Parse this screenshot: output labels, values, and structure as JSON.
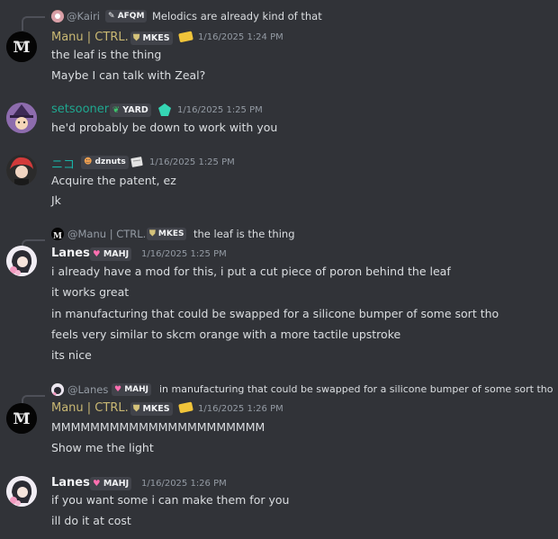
{
  "messages": {
    "m1": {
      "reply": {
        "name": "@Kairi",
        "tag": "AFQM",
        "text": "Melodics are already kind of that"
      },
      "author": "Manu | CTRL.",
      "tag": "MKES",
      "time": "1/16/2025 1:24 PM",
      "lines": [
        "the leaf is the thing",
        "Maybe I can talk with Zeal?"
      ]
    },
    "m2": {
      "author": "setsooner",
      "tag": "YARD",
      "time": "1/16/2025 1:25 PM",
      "lines": [
        "he'd probably be down to work with you"
      ]
    },
    "m3": {
      "author": "ニコ",
      "tag": "dznuts",
      "time": "1/16/2025 1:25 PM",
      "lines": [
        "Acquire the patent, ez",
        "Jk"
      ]
    },
    "m4": {
      "reply": {
        "name": "@Manu | CTRL.",
        "tag": "MKES",
        "text": "the leaf is the thing"
      },
      "author": "Lanes",
      "tag": "MAHJ",
      "time": "1/16/2025 1:25 PM",
      "lines": [
        "i already have a mod for this, i put a cut piece of poron behind the leaf",
        "it works great",
        "in manufacturing that could be swapped for a silicone bumper of some sort tho",
        "feels very similar to skcm orange with a more tactile upstroke",
        "its nice"
      ]
    },
    "m5": {
      "reply": {
        "name": "@Lanes",
        "tag": "MAHJ",
        "text": "in manufacturing that could be swapped for a silicone bumper of some sort tho"
      },
      "author": "Manu | CTRL.",
      "tag": "MKES",
      "time": "1/16/2025 1:26 PM",
      "lines": [
        "MMMMMMMMMMMMMMMMMMMMMM",
        "Show me the light"
      ]
    },
    "m6": {
      "author": "Lanes",
      "tag": "MAHJ",
      "time": "1/16/2025 1:26 PM",
      "lines": [
        "if you want some i can make them for you",
        "ill do it at cost"
      ]
    }
  },
  "colors": {
    "background": "#313338",
    "text": "#dbdee1",
    "muted": "#949ba4",
    "manu": "#c9b873",
    "setsooner": "#1fa890",
    "niko": "#19b3a7",
    "lanes_badge": "#ff6fb0"
  },
  "icons": {
    "manu_avatar": "m-logo-avatar",
    "setsooner_avatar": "witch-avatar",
    "niko_avatar": "red-hair-avatar",
    "lanes_avatar": "anime-avatar",
    "afqm_badge": "pen-icon",
    "mkes_badge": "shield-icon",
    "yard_badge": "leaf-icon",
    "mahj_badge": "heart-icon",
    "dznuts_badge": "face-icon",
    "manu_extra": "ticket-icon",
    "setsooner_extra": "gem-icon",
    "niko_extra": "note-icon"
  }
}
